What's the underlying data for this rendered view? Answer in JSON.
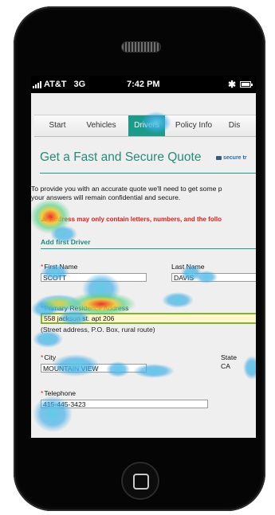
{
  "statusbar": {
    "carrier": "AT&T",
    "network": "3G",
    "time": "7:42 PM",
    "bluetooth_icon": "bluetooth-icon",
    "battery_icon": "battery-icon"
  },
  "nav": {
    "tabs": [
      {
        "label": "Start",
        "active": false
      },
      {
        "label": "Vehicles",
        "active": false
      },
      {
        "label": "Drivers",
        "active": true
      },
      {
        "label": "Policy Info",
        "active": false
      },
      {
        "label": "Dis",
        "active": false
      }
    ]
  },
  "page": {
    "title": "Get a Fast and Secure Quote",
    "secure_badge": "secure tr",
    "intro_line1": "To provide you with an accurate quote we'll need to get some p",
    "intro_line2": "your answers will remain confidential and secure.",
    "error_message": "Address may only contain letters, numbers, and the follo",
    "section_title": "Add first Driver"
  },
  "form": {
    "first_name": {
      "label": "First Name",
      "value": "SCOTT"
    },
    "last_name": {
      "label": "Last Name",
      "value": "DAVIS"
    },
    "address": {
      "label": "Primary Residence Address",
      "value": "558 jackson st. apt 206",
      "hint": "(Street address, P.O. Box, rural route)"
    },
    "city": {
      "label": "City",
      "value": "MOUNTAIN VIEW"
    },
    "state": {
      "label": "State",
      "value": "CA"
    },
    "telephone": {
      "label": "Telephone",
      "value": "415-445-3423"
    },
    "required_marker": "*"
  },
  "colors": {
    "accent": "#1c9b8a",
    "error": "#d91c1c",
    "highlight_border": "#7fb22e"
  }
}
